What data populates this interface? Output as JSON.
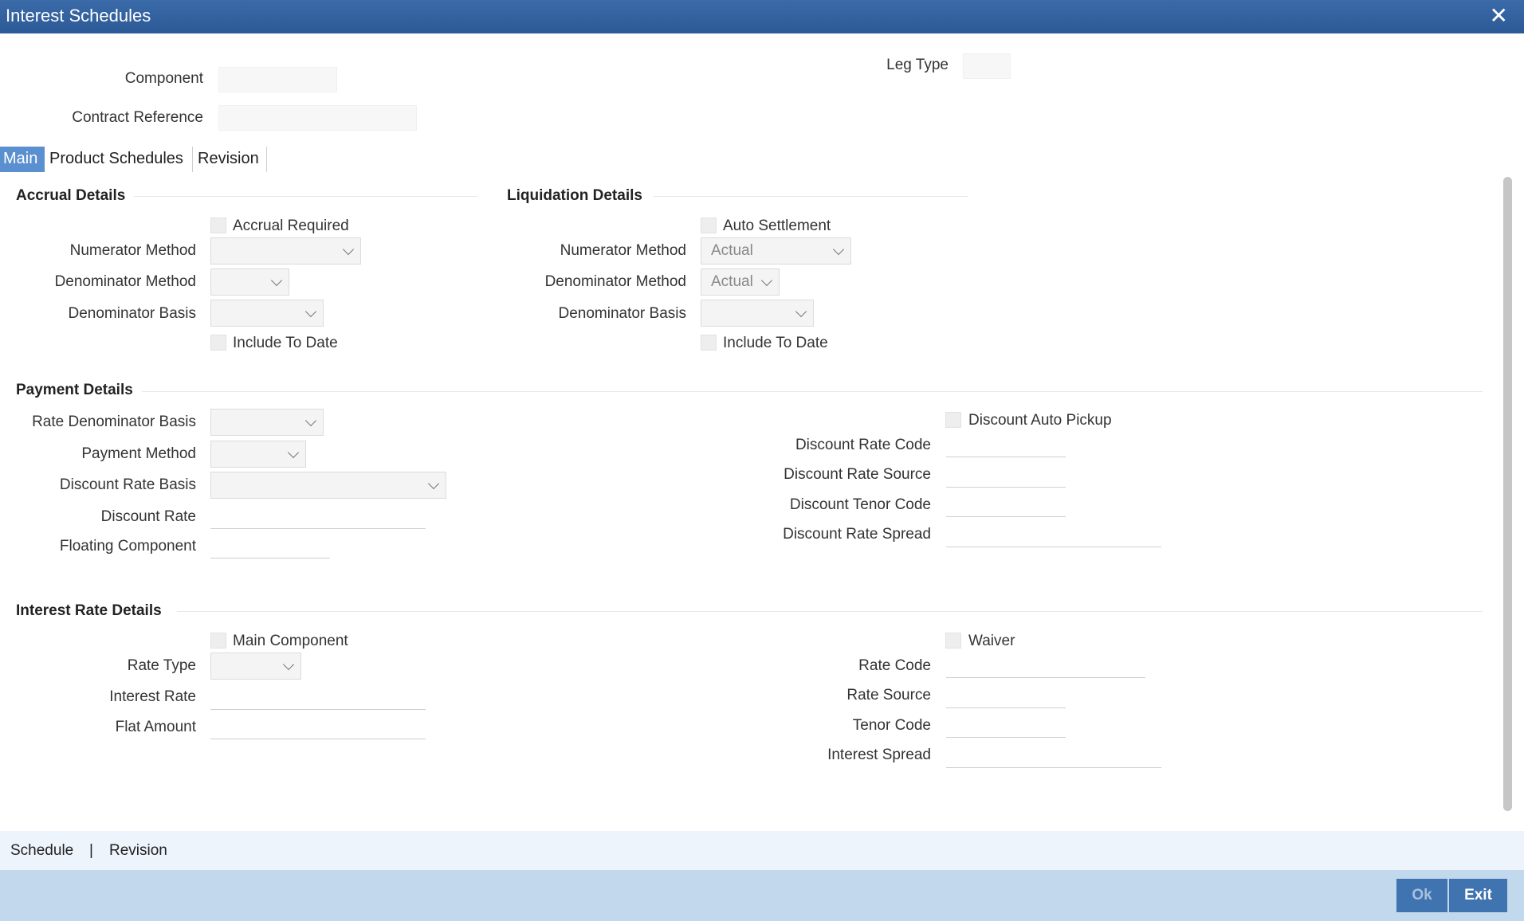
{
  "window": {
    "title": "Interest Schedules"
  },
  "header": {
    "component_label": "Component",
    "contract_reference_label": "Contract Reference",
    "leg_type_label": "Leg Type"
  },
  "tabs": [
    {
      "label": "Main",
      "active": true
    },
    {
      "label": "Product Schedules",
      "active": false
    },
    {
      "label": "Revision",
      "active": false
    }
  ],
  "accrual": {
    "title": "Accrual Details",
    "accrual_required": "Accrual Required",
    "numerator_method": "Numerator Method",
    "denominator_method": "Denominator Method",
    "denominator_basis": "Denominator Basis",
    "include_to_date": "Include To Date"
  },
  "liquidation": {
    "title": "Liquidation Details",
    "auto_settlement": "Auto Settlement",
    "numerator_method": "Numerator Method",
    "numerator_value": "Actual",
    "denominator_method": "Denominator Method",
    "denominator_value": "Actual",
    "denominator_basis": "Denominator Basis",
    "include_to_date": "Include To Date"
  },
  "payment": {
    "title": "Payment Details",
    "rate_denominator_basis": "Rate Denominator Basis",
    "payment_method": "Payment Method",
    "discount_rate_basis": "Discount Rate Basis",
    "discount_rate": "Discount Rate",
    "floating_component": "Floating Component",
    "discount_auto_pickup": "Discount Auto Pickup",
    "discount_rate_code": "Discount Rate Code",
    "discount_rate_source": "Discount Rate Source",
    "discount_tenor_code": "Discount Tenor Code",
    "discount_rate_spread": "Discount Rate Spread"
  },
  "interest": {
    "title": "Interest Rate Details",
    "main_component": "Main Component",
    "rate_type": "Rate Type",
    "interest_rate": "Interest Rate",
    "flat_amount": "Flat Amount",
    "waiver": "Waiver",
    "rate_code": "Rate Code",
    "rate_source": "Rate Source",
    "tenor_code": "Tenor Code",
    "interest_spread": "Interest Spread"
  },
  "footer": {
    "schedule_link": "Schedule",
    "separator": "|",
    "revision_link": "Revision",
    "ok_label": "Ok",
    "exit_label": "Exit"
  }
}
